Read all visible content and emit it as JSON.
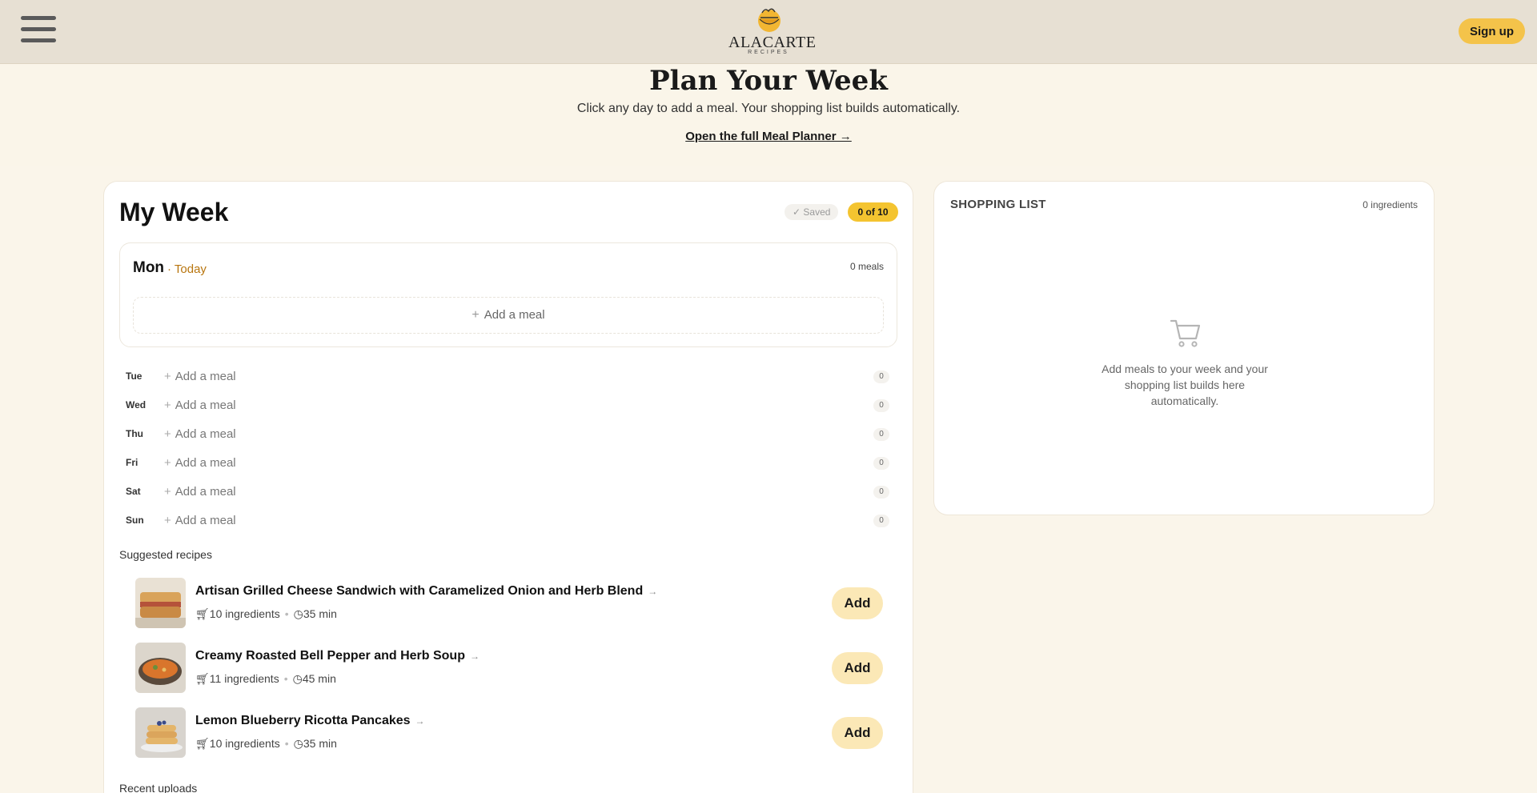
{
  "header": {
    "menu_icon": "hamburger-menu-icon",
    "logo_text": "ALACARTE",
    "logo_subtext": "RECIPES",
    "signup_label": "Sign up"
  },
  "hero": {
    "title": "Plan Your Week",
    "subtitle": "Click any day to add a meal. Your shopping list builds automatically.",
    "planner_link": "Open the full Meal Planner →"
  },
  "week": {
    "title": "My Week",
    "saved_label": "Saved",
    "count_label": "0 of 10",
    "today": {
      "day": "Mon",
      "today_label": "· Today",
      "meal_count": "0 meals",
      "add_label": "Add a meal"
    },
    "days": [
      {
        "day": "Tue",
        "add_label": "Add a meal",
        "count": "0"
      },
      {
        "day": "Wed",
        "add_label": "Add a meal",
        "count": "0"
      },
      {
        "day": "Thu",
        "add_label": "Add a meal",
        "count": "0"
      },
      {
        "day": "Fri",
        "add_label": "Add a meal",
        "count": "0"
      },
      {
        "day": "Sat",
        "add_label": "Add a meal",
        "count": "0"
      },
      {
        "day": "Sun",
        "add_label": "Add a meal",
        "count": "0"
      }
    ],
    "suggested_title": "Suggested recipes",
    "recipes": [
      {
        "name": "Artisan Grilled Cheese Sandwich with Caramelized Onion and Herb Blend",
        "ingredients": "10 ingredients",
        "time": "35 min",
        "add_label": "Add"
      },
      {
        "name": "Creamy Roasted Bell Pepper and Herb Soup",
        "ingredients": "11 ingredients",
        "time": "45 min",
        "add_label": "Add"
      },
      {
        "name": "Lemon Blueberry Ricotta Pancakes",
        "ingredients": "10 ingredients",
        "time": "35 min",
        "add_label": "Add"
      }
    ],
    "recent_title": "Recent uploads"
  },
  "shopping": {
    "title": "SHOPPING LIST",
    "count": "0 ingredients",
    "empty_text": "Add meals to your week and your shopping list builds here automatically."
  },
  "colors": {
    "accent": "#f4c430",
    "topbar_bg": "#e7e0d3",
    "page_bg": "#faf5ea",
    "today": "#b8750e"
  }
}
